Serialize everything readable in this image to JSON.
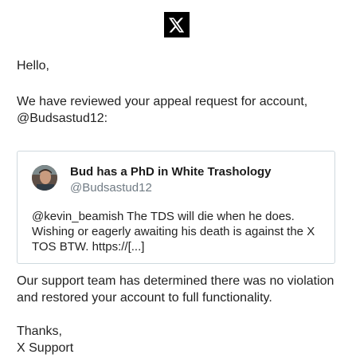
{
  "logo": {
    "icon": "x-logo-icon"
  },
  "email": {
    "greeting": "Hello,",
    "intro": "We have reviewed your appeal request for account, @Budsastud12:",
    "tweet": {
      "display_name": "Bud has a PhD in White Trashology",
      "handle": "@Budsastud12",
      "text": "@kevin_beamish The TDS will die when he does. Wishing or eagerly awaiting his death is against the X TOS BTW. https://[...]"
    },
    "resolution": "Our support team has determined there was no violation and restored your account to full functionality.",
    "signoff": "Thanks,",
    "signature": "X Support"
  },
  "colors": {
    "logo_bg": "#000000",
    "text": "#222222",
    "handle": "#707b84",
    "card_border": "#cfd9de"
  }
}
